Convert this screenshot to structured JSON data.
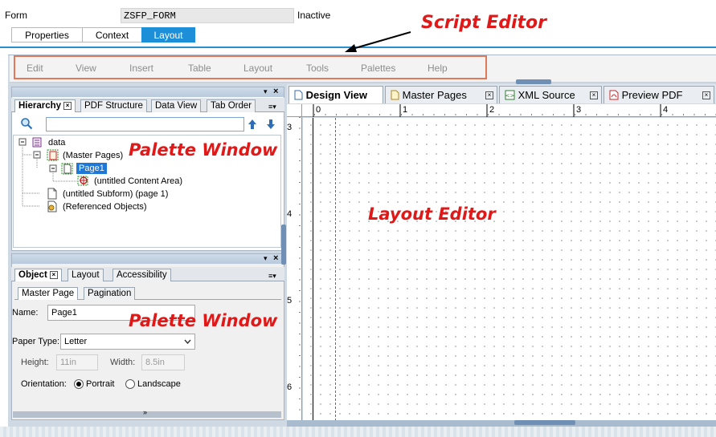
{
  "header": {
    "form_label": "Form",
    "form_name": "ZSFP_FORM",
    "status": "Inactive",
    "tabs": [
      {
        "label": "Properties",
        "active": false
      },
      {
        "label": "Context",
        "active": false
      },
      {
        "label": "Layout",
        "active": true
      }
    ]
  },
  "annotations": {
    "script_editor": "Script Editor",
    "palette_window_top": "Palette Window",
    "palette_window_bottom": "Palette Window",
    "layout_editor": "Layout Editor",
    "color": "#e01818"
  },
  "menubar": {
    "items": [
      "Edit",
      "View",
      "Insert",
      "Table",
      "Layout",
      "Tools",
      "Palettes",
      "Help"
    ]
  },
  "hierarchy_palette": {
    "tabs": [
      {
        "label": "Hierarchy",
        "active": true
      },
      {
        "label": "PDF Structure",
        "active": false
      },
      {
        "label": "Data View",
        "active": false
      },
      {
        "label": "Tab Order",
        "active": false
      }
    ],
    "tree": [
      {
        "label": "data",
        "icon": "data-icon"
      },
      {
        "label": "(Master Pages)",
        "icon": "master-pages-icon"
      },
      {
        "label": "Page1",
        "icon": "page-icon",
        "selected": true
      },
      {
        "label": "(untitled Content Area)",
        "icon": "content-area-icon"
      },
      {
        "label": "(untitled Subform) (page 1)",
        "icon": "subform-icon"
      },
      {
        "label": "(Referenced Objects)",
        "icon": "referenced-objects-icon"
      }
    ]
  },
  "object_palette": {
    "tabs": [
      {
        "label": "Object",
        "active": true
      },
      {
        "label": "Layout",
        "active": false
      },
      {
        "label": "Accessibility",
        "active": false
      }
    ],
    "subtabs": [
      {
        "label": "Master Page",
        "active": true
      },
      {
        "label": "Pagination",
        "active": false
      }
    ],
    "name_label": "Name:",
    "name_value": "Page1",
    "paper_type_label": "Paper Type:",
    "paper_type_value": "Letter",
    "height_label": "Height:",
    "height_value": "11in",
    "width_label": "Width:",
    "width_value": "8.5in",
    "orientation_label": "Orientation:",
    "orientation_options": [
      {
        "label": "Portrait",
        "checked": true
      },
      {
        "label": "Landscape",
        "checked": false
      }
    ]
  },
  "document_tabs": [
    {
      "label": "Design View",
      "active": true,
      "icon": "page-icon"
    },
    {
      "label": "Master Pages",
      "active": false,
      "icon": "master-page-icon"
    },
    {
      "label": "XML Source",
      "active": false,
      "icon": "xml-icon"
    },
    {
      "label": "Preview PDF",
      "active": false,
      "icon": "pdf-icon"
    }
  ],
  "rulers": {
    "horizontal": [
      "0",
      "1",
      "2",
      "3",
      "4"
    ],
    "vertical": [
      "3",
      "4",
      "5",
      "6"
    ]
  }
}
